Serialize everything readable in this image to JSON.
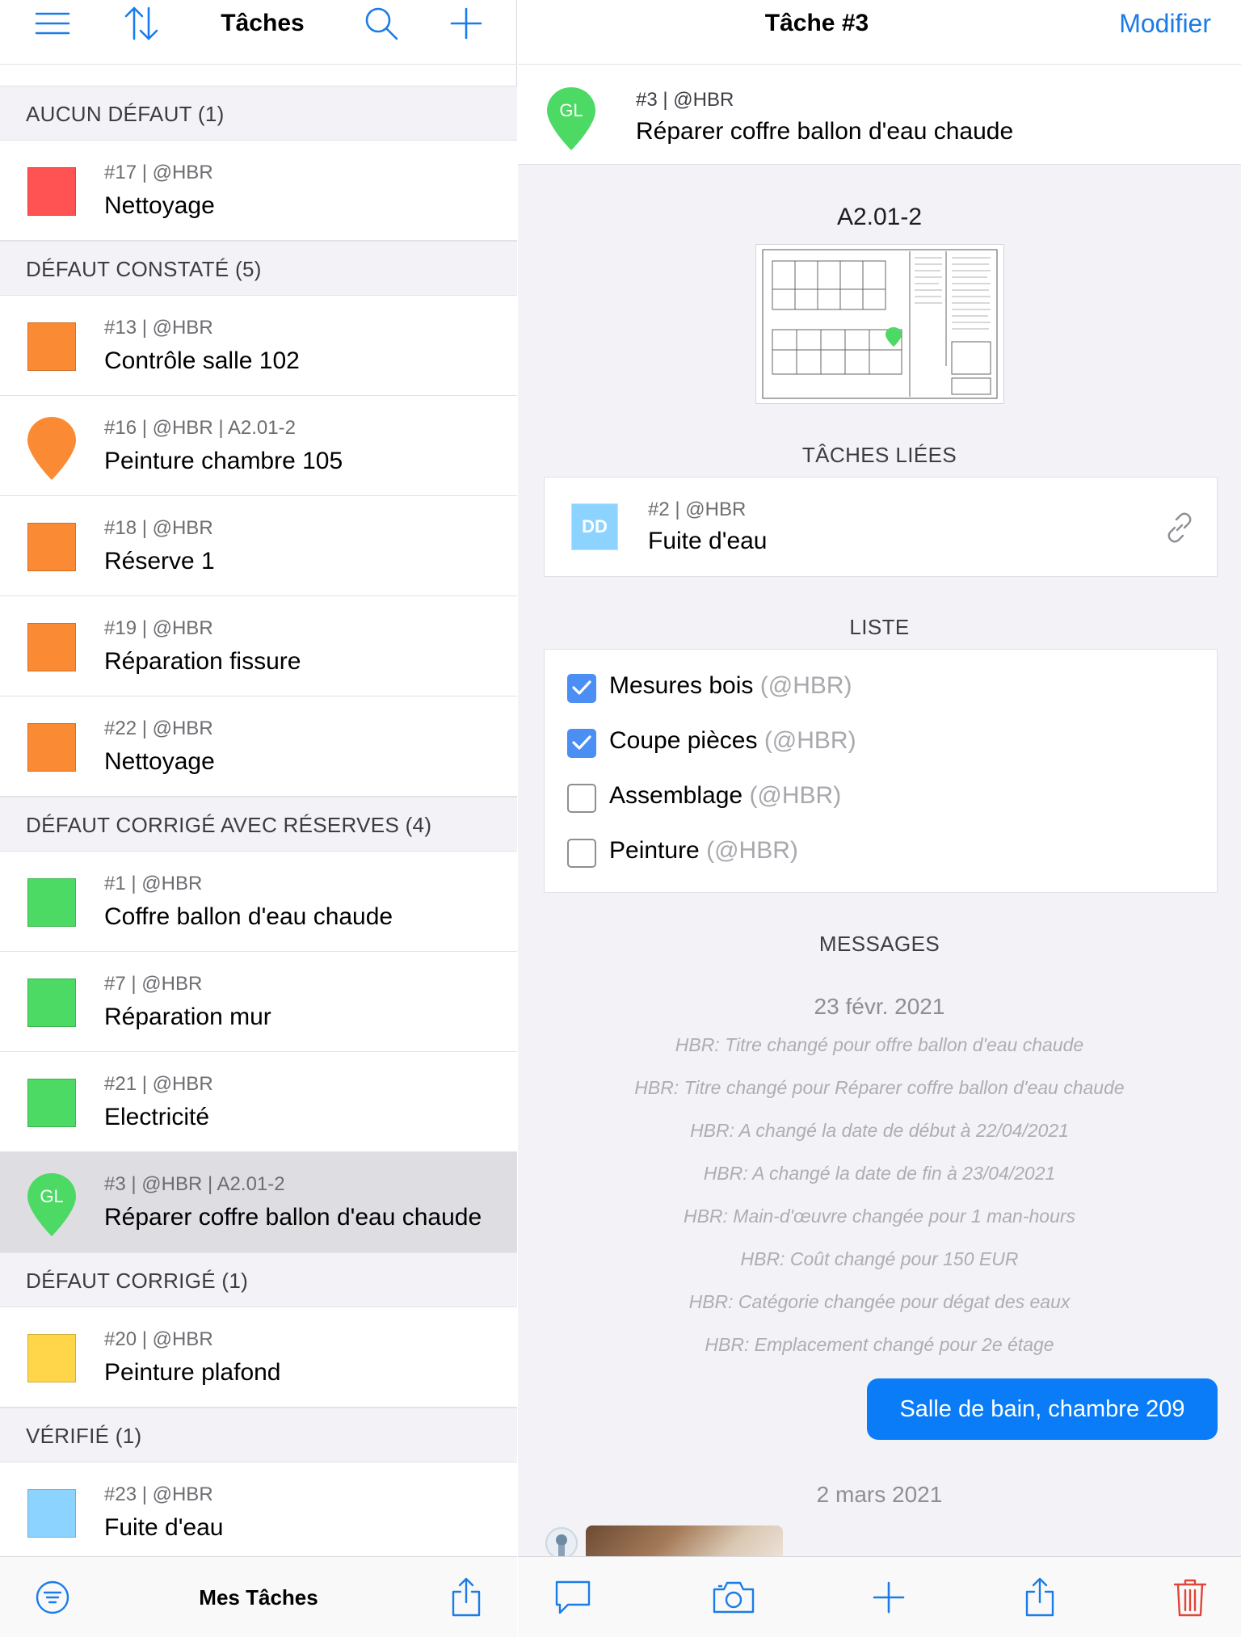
{
  "colors": {
    "accent": "#1a7ce8",
    "no_defect": "#ff5252",
    "defect_found": "#fb8a34",
    "corrected_with_reserves": "#4cd964",
    "corrected": "#ffd54a",
    "verified": "#8dd3ff",
    "delete": "#e0453a"
  },
  "left_nav": {
    "menu_icon": "menu-icon",
    "sort_icon": "sort-icon",
    "title": "Tâches",
    "search_icon": "search-icon",
    "add_icon": "plus-icon"
  },
  "sections": [
    {
      "header": "AUCUN DÉFAUT (1)",
      "items": [
        {
          "meta": "#17 | @HBR",
          "label": "Nettoyage",
          "marker": "square",
          "color": "#ff5252"
        }
      ]
    },
    {
      "header": "DÉFAUT CONSTATÉ (5)",
      "items": [
        {
          "meta": "#13 | @HBR",
          "label": "Contrôle salle 102",
          "marker": "square",
          "color": "#fb8a34"
        },
        {
          "meta": "#16 | @HBR | A2.01-2",
          "label": "Peinture chambre 105",
          "marker": "pin",
          "color": "#fb8a34",
          "pin_text": ""
        },
        {
          "meta": "#18 | @HBR",
          "label": "Réserve 1",
          "marker": "square",
          "color": "#fb8a34"
        },
        {
          "meta": "#19 | @HBR",
          "label": "Réparation fissure",
          "marker": "square",
          "color": "#fb8a34"
        },
        {
          "meta": "#22 | @HBR",
          "label": "Nettoyage",
          "marker": "square",
          "color": "#fb8a34"
        }
      ]
    },
    {
      "header": "DÉFAUT CORRIGÉ AVEC RÉSERVES (4)",
      "items": [
        {
          "meta": "#1 | @HBR",
          "label": "Coffre ballon d'eau chaude",
          "marker": "square",
          "color": "#4cd964"
        },
        {
          "meta": "#7 | @HBR",
          "label": "Réparation mur",
          "marker": "square",
          "color": "#4cd964"
        },
        {
          "meta": "#21 | @HBR",
          "label": "Electricité",
          "marker": "square",
          "color": "#4cd964"
        },
        {
          "meta": "#3 | @HBR | A2.01-2",
          "label": "Réparer coffre ballon d'eau chaude",
          "marker": "pin",
          "color": "#4cd964",
          "pin_text": "GL",
          "selected": true
        }
      ]
    },
    {
      "header": "DÉFAUT CORRIGÉ (1)",
      "items": [
        {
          "meta": "#20 | @HBR",
          "label": "Peinture plafond",
          "marker": "square",
          "color": "#ffd54a"
        }
      ]
    },
    {
      "header": "VÉRIFIÉ (1)",
      "items": [
        {
          "meta": "#23 | @HBR",
          "label": "Fuite d'eau",
          "marker": "square",
          "color": "#8dd3ff"
        }
      ]
    }
  ],
  "left_bottom": {
    "filter_icon": "filter-icon",
    "title": "Mes Tâches",
    "share_icon": "share-icon"
  },
  "right_nav": {
    "title": "Tâche #3",
    "edit_label": "Modifier"
  },
  "task": {
    "pin_text": "GL",
    "meta": "#3 | @HBR",
    "title": "Réparer coffre ballon d'eau chaude"
  },
  "plan": {
    "title": "A2.01-2"
  },
  "linked": {
    "section_label": "TÂCHES LIÉES",
    "badge": "DD",
    "meta": "#2 | @HBR",
    "title": "Fuite d'eau",
    "link_icon": "link-icon"
  },
  "checklist": {
    "section_label": "LISTE",
    "items": [
      {
        "text": "Mesures bois",
        "who": "(@HBR)",
        "checked": true
      },
      {
        "text": "Coupe pièces",
        "who": "(@HBR)",
        "checked": true
      },
      {
        "text": "Assemblage",
        "who": "(@HBR)",
        "checked": false
      },
      {
        "text": "Peinture",
        "who": "(@HBR)",
        "checked": false
      }
    ]
  },
  "messages": {
    "section_label": "MESSAGES",
    "date1": "23 févr. 2021",
    "log": [
      "HBR: Titre changé pour offre ballon d'eau chaude",
      "HBR: Titre changé pour Réparer coffre ballon d'eau chaude",
      "HBR: A changé la date de début à 22/04/2021",
      "HBR: A changé la date de fin à 23/04/2021",
      "HBR: Main-d'œuvre changée pour 1 man-hours",
      "HBR: Coût changé pour 150 EUR",
      "HBR: Catégorie changée pour dégat des eaux",
      "HBR: Emplacement changé pour 2e étage"
    ],
    "bubble": "Salle de bain, chambre 209",
    "date2": "2 mars 2021"
  },
  "right_bottom": {
    "comment_icon": "comment-icon",
    "camera_icon": "camera-icon",
    "add_icon": "plus-icon",
    "share_icon": "share-icon",
    "trash_icon": "trash-icon"
  }
}
